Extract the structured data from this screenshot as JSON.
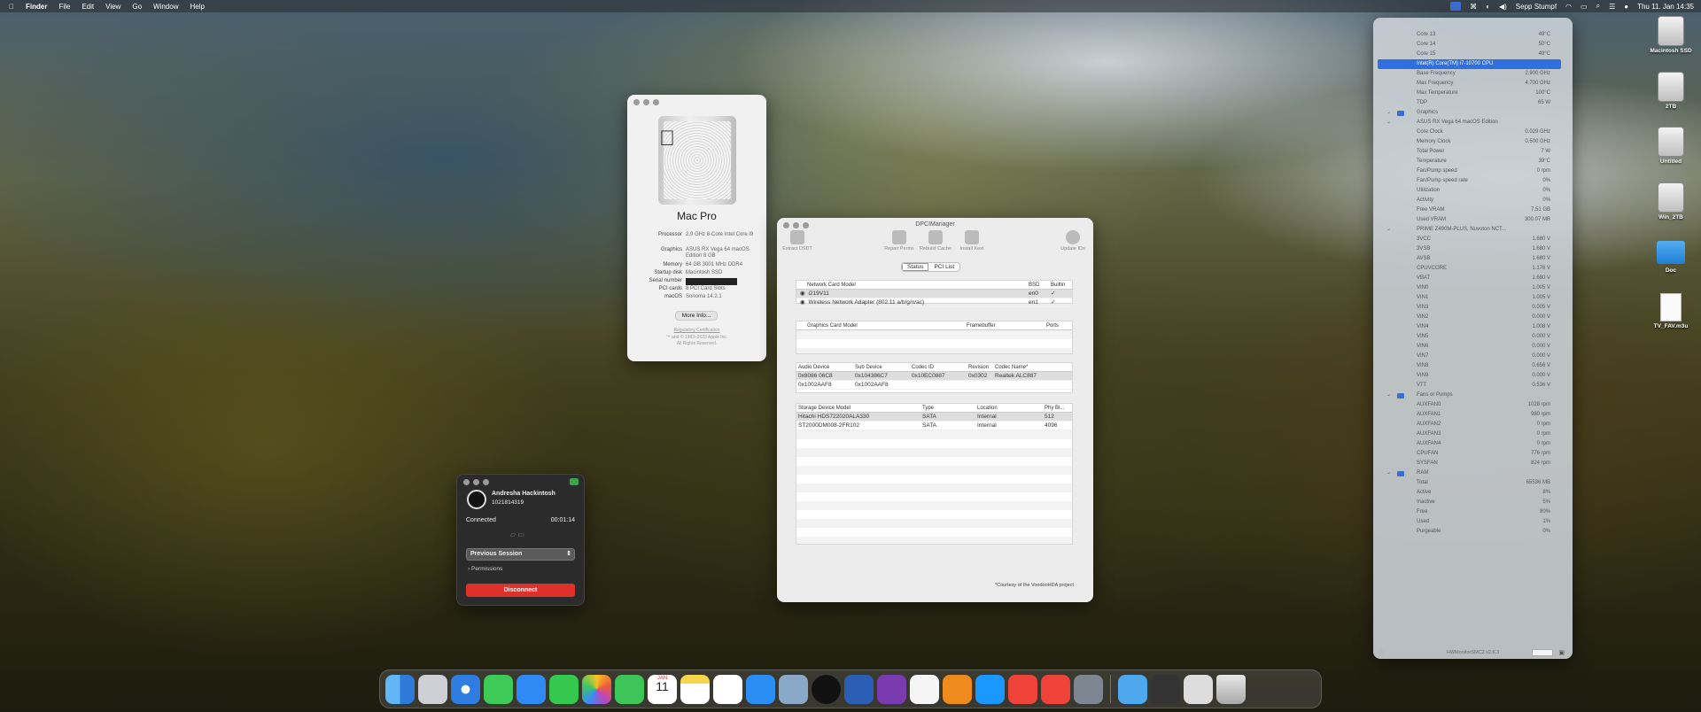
{
  "menubar": {
    "app": "Finder",
    "items": [
      "File",
      "Edit",
      "View",
      "Go",
      "Window",
      "Help"
    ],
    "user": "Sepp Stumpf",
    "datetime": "Thu 11. Jan  14:35"
  },
  "about": {
    "model": "Mac Pro",
    "specs": [
      {
        "k": "Processor",
        "v": "2,9 GHz 8-Core Intel Core i9"
      },
      {
        "k": "Graphics",
        "v": "ASUS RX Vega 64 macOS Edition 8 GB"
      },
      {
        "k": "Memory",
        "v": "64 GB 3001 MHz DDR4"
      },
      {
        "k": "Startup disk",
        "v": "Macintosh SSD"
      },
      {
        "k": "Serial number",
        "v": ""
      },
      {
        "k": "PCI cards",
        "v": "8 PCI Card Slots"
      },
      {
        "k": "macOS",
        "v": "Sonoma 14.2.1"
      }
    ],
    "more_info": "More Info...",
    "reg": "Regulatory Certification",
    "copy1": "™ and © 1983–2023 Apple Inc.",
    "copy2": "All Rights Reserved."
  },
  "remote": {
    "name": "Andresha Hackintosh",
    "id": "1021814319",
    "status": "Connected",
    "timer": "00:01:14",
    "session": "Previous Session",
    "permissions": "Permissions",
    "disconnect": "Disconnect"
  },
  "dpci": {
    "title": "DPCIManager",
    "tools": [
      "Extract DSDT",
      "Repair Perms",
      "Rebuild Cache",
      "Install Kext",
      "Update IDs"
    ],
    "tabs": [
      "Status",
      "PCI List"
    ],
    "net_headers": [
      "Network Card Model",
      "BSD",
      "Builtin"
    ],
    "net_rows": [
      [
        "i219V11",
        "en0",
        "✓"
      ],
      [
        "Wireless Network Adapter (802.11 a/b/g/n/ac)",
        "en1",
        "✓"
      ]
    ],
    "gfx_headers": [
      "Graphics Card Model",
      "Framebuffer",
      "Ports"
    ],
    "audio_headers": [
      "Audio Device",
      "Sub Device",
      "Codec ID",
      "Revision",
      "Codec Name*"
    ],
    "audio_rows": [
      [
        "0x8086 06C8",
        "0x104386C7",
        "0x10EC0887",
        "0x0302",
        "Realtek ALC887"
      ],
      [
        "0x1002AAF8",
        "0x1002AAF8",
        "",
        "",
        ""
      ]
    ],
    "storage_headers": [
      "Storage Device Model",
      "Type",
      "Location",
      "Phy Bl..."
    ],
    "storage_rows": [
      [
        "Hitachi HDS722020ALA330",
        "SATA",
        "Internal",
        "512"
      ],
      [
        "ST2000DM008-2FR102",
        "SATA",
        "Internal",
        "4096"
      ]
    ],
    "footer": "*Courtesy of the VoodooHDA project"
  },
  "hwm": {
    "rows": [
      {
        "t": "row",
        "k": "Core 13",
        "v": "49°C"
      },
      {
        "t": "row",
        "k": "Core 14",
        "v": "50°C"
      },
      {
        "t": "row",
        "k": "Core 15",
        "v": "49°C"
      },
      {
        "t": "hl",
        "k": "Intel(R) Core(TM) i7-10700 CPU",
        "v": ""
      },
      {
        "t": "row",
        "k": "Base Frequency",
        "v": "2.900 GHz"
      },
      {
        "t": "row",
        "k": "Max Frequency",
        "v": "4.700 GHz"
      },
      {
        "t": "row",
        "k": "Max Temperature",
        "v": "100°C"
      },
      {
        "t": "row",
        "k": "TDP",
        "v": "65 W"
      },
      {
        "t": "grp",
        "k": "Graphics",
        "v": ""
      },
      {
        "t": "sub",
        "k": "ASUS RX Vega 64 macOS Edition",
        "v": ""
      },
      {
        "t": "row",
        "k": "Core Clock",
        "v": "0.029 GHz"
      },
      {
        "t": "row",
        "k": "Memory Clock",
        "v": "0.500 GHz"
      },
      {
        "t": "row",
        "k": "Total Power",
        "v": "7 W"
      },
      {
        "t": "row",
        "k": "Temperature",
        "v": "39°C"
      },
      {
        "t": "row",
        "k": "Fan/Pump speed",
        "v": "0 rpm"
      },
      {
        "t": "row",
        "k": "Fan/Pump speed rate",
        "v": "0%"
      },
      {
        "t": "row",
        "k": "Utilization",
        "v": "0%"
      },
      {
        "t": "row",
        "k": "Activity",
        "v": "0%"
      },
      {
        "t": "row",
        "k": "Free VRAM",
        "v": "7.51 GB"
      },
      {
        "t": "row",
        "k": "Used VRAM",
        "v": "300.07 MB"
      },
      {
        "t": "sub",
        "k": "PRIME Z490M-PLUS, Nuvoton NCT...",
        "v": ""
      },
      {
        "t": "row",
        "k": "3VCC",
        "v": "1.680 V"
      },
      {
        "t": "row",
        "k": "3VSB",
        "v": "1.680 V"
      },
      {
        "t": "row",
        "k": "AVSB",
        "v": "1.680 V"
      },
      {
        "t": "row",
        "k": "CPUVCORE",
        "v": "1.176 V"
      },
      {
        "t": "row",
        "k": "VBAT",
        "v": "1.680 V"
      },
      {
        "t": "row",
        "k": "VIN0",
        "v": "1.005 V"
      },
      {
        "t": "row",
        "k": "VIN1",
        "v": "1.005 V"
      },
      {
        "t": "row",
        "k": "VIN3",
        "v": "0.005 V"
      },
      {
        "t": "row",
        "k": "VIN2",
        "v": "0.000 V"
      },
      {
        "t": "row",
        "k": "VIN4",
        "v": "1.008 V"
      },
      {
        "t": "row",
        "k": "VIN5",
        "v": "0.000 V"
      },
      {
        "t": "row",
        "k": "VIN6",
        "v": "0.000 V"
      },
      {
        "t": "row",
        "k": "VIN7",
        "v": "0.000 V"
      },
      {
        "t": "row",
        "k": "VIN8",
        "v": "0.656 V"
      },
      {
        "t": "row",
        "k": "VIN9",
        "v": "0.000 V"
      },
      {
        "t": "row",
        "k": "VTT",
        "v": "0.536 V"
      },
      {
        "t": "grp",
        "k": "Fans or Pumps",
        "v": ""
      },
      {
        "t": "row",
        "k": "AUXFAN0",
        "v": "1028 rpm"
      },
      {
        "t": "row",
        "k": "AUXFAN1",
        "v": "980 rpm"
      },
      {
        "t": "row",
        "k": "AUXFAN2",
        "v": "0 rpm"
      },
      {
        "t": "row",
        "k": "AUXFAN3",
        "v": "0 rpm"
      },
      {
        "t": "row",
        "k": "AUXFAN4",
        "v": "0 rpm"
      },
      {
        "t": "row",
        "k": "CPUFAN",
        "v": "776 rpm"
      },
      {
        "t": "row",
        "k": "SYSFAN",
        "v": "824 rpm"
      },
      {
        "t": "grp",
        "k": "RAM",
        "v": ""
      },
      {
        "t": "row",
        "k": "Total",
        "v": "65536 MB"
      },
      {
        "t": "row",
        "k": "Active",
        "v": "8%"
      },
      {
        "t": "row",
        "k": "Inactive",
        "v": "5%"
      },
      {
        "t": "row",
        "k": "Free",
        "v": "80%"
      },
      {
        "t": "row",
        "k": "Used",
        "v": "1%"
      },
      {
        "t": "row",
        "k": "Purgeable",
        "v": "0%"
      }
    ],
    "footer": "HWMonitorSMC2 v2.6.3"
  },
  "desktop": [
    "Macintosh SSD",
    "2TB",
    "Untitled",
    "Win_2TB",
    "Doc",
    "TV_FAV.m3u"
  ],
  "dock": [
    "Finder",
    "Launchpad",
    "Safari",
    "Messages",
    "Mail",
    "WhatsApp",
    "Photos",
    "FaceTime",
    "Calendar",
    "Notes",
    "Freeform",
    "App Store",
    "Preview",
    "Spotify",
    "Word",
    "OneNote",
    "Script Editor",
    "VLC",
    "Prime Video",
    "AnyDesk",
    "AnyDesk Client",
    "System Information",
    "Downloads",
    "Terminal",
    "Documents",
    "Trash"
  ],
  "calendar": {
    "month": "JAN",
    "day": "11"
  },
  "colors": {
    "accent": "#2f6fe0",
    "disconnect": "#e0302a"
  }
}
